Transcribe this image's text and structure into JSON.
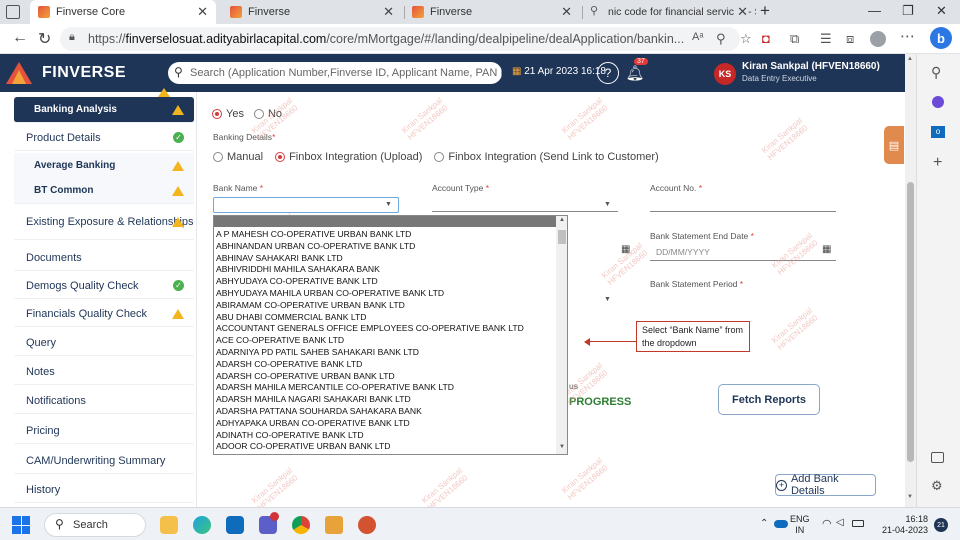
{
  "browser": {
    "tabs": [
      {
        "title": "Finverse Core",
        "active": true
      },
      {
        "title": "Finverse",
        "active": false
      },
      {
        "title": "Finverse",
        "active": false
      },
      {
        "title": "nic code for financial services - S",
        "active": false
      }
    ],
    "url_prefix": "https://",
    "url_host": "finverselosuat.adityabirlacapital.com",
    "url_path": "/core/mMortgage/#/landing/dealpipeline/dealApplication/bankin..."
  },
  "app": {
    "brand": "FINVERSE",
    "search_placeholder": "Search (Application Number,Finverse ID, Applicant Name, PAN Number)",
    "datetime": "21 Apr 2023 16:18",
    "notification_count": "37",
    "user_initials": "KS",
    "user_name": "Kiran Sankpal (HFVEN18660)",
    "user_role": "Data Entry Executive"
  },
  "sidebar": {
    "items": [
      {
        "label": "Banking Analysis",
        "status": "warn",
        "sub": true,
        "active": true
      },
      {
        "label": "Product Details",
        "status": "ok",
        "sub": false,
        "active": false
      },
      {
        "label": "Average Banking",
        "status": "warn",
        "sub": true,
        "active": false
      },
      {
        "label": "BT Common",
        "status": "warn",
        "sub": true,
        "active": false
      },
      {
        "label": "Existing Exposure & Relationships",
        "status": "warn",
        "sub": false,
        "active": false
      },
      {
        "label": "Documents",
        "status": "",
        "sub": false,
        "active": false
      },
      {
        "label": "Demogs Quality Check",
        "status": "ok",
        "sub": false,
        "active": false
      },
      {
        "label": "Financials Quality Check",
        "status": "warn",
        "sub": false,
        "active": false
      },
      {
        "label": "Query",
        "status": "",
        "sub": false,
        "active": false
      },
      {
        "label": "Notes",
        "status": "",
        "sub": false,
        "active": false
      },
      {
        "label": "Notifications",
        "status": "",
        "sub": false,
        "active": false
      },
      {
        "label": "Pricing",
        "status": "",
        "sub": false,
        "active": false
      },
      {
        "label": "CAM/Underwriting Summary",
        "status": "",
        "sub": false,
        "active": false
      },
      {
        "label": "History",
        "status": "",
        "sub": false,
        "active": false
      }
    ]
  },
  "form": {
    "yes_label": "Yes",
    "no_label": "No",
    "banking_details_label": "Banking Details",
    "mode_manual": "Manual",
    "mode_finbox_upload": "Finbox Integration (Upload)",
    "mode_finbox_link": "Finbox Integration (Send Link to Customer)",
    "bank_name_label": "Bank Name",
    "account_type_label": "Account Type",
    "account_no_label": "Account No.",
    "stmt_end_label": "Bank Statement End Date",
    "stmt_end_placeholder": "DD/MM/YYYY",
    "stmt_period_label": "Bank Statement Period",
    "status_label_partial": "us",
    "status_value_partial": "PROGRESS",
    "fetch_reports": "Fetch Reports",
    "add_bank_details": "Add Bank Details"
  },
  "bank_dropdown": {
    "options": [
      "A P MAHESH CO-OPERATIVE URBAN BANK LTD",
      "ABHINANDAN URBAN CO-OPERATIVE BANK LTD",
      "ABHINAV SAHAKARI BANK LTD",
      "ABHIVRIDDHI MAHILA SAHAKARA BANK",
      "ABHYUDAYA CO-OPERATIVE BANK LTD",
      "ABHYUDAYA MAHILA URBAN CO-OPERATIVE BANK LTD",
      "ABIRAMAM CO-OPERATIVE URBAN BANK LTD",
      "ABU DHABI COMMERCIAL BANK LTD",
      "ACCOUNTANT GENERALS OFFICE EMPLOYEES CO-OPERATIVE BANK LTD",
      "ACE CO-OPERATIVE BANK LTD",
      "ADARNIYA PD PATIL SAHEB SAHAKARI BANK LTD",
      "ADARSH CO-OPERATIVE BANK LTD",
      "ADARSH CO-OPERATIVE URBAN BANK LTD",
      "ADARSH MAHILA MERCANTILE CO-OPERATIVE BANK LTD",
      "ADARSH MAHILA NAGARI SAHAKARI BANK LTD",
      "ADARSHA PATTANA SOUHARDA SAHAKARA BANK",
      "ADHYAPAKA URBAN CO-OPERATIVE BANK LTD",
      "ADINATH CO-OPERATIVE BANK LTD",
      "ADOOR CO-OPERATIVE URBAN BANK LTD"
    ]
  },
  "callout": {
    "text": "Select “Bank Name” from the dropdown"
  },
  "watermark": {
    "line1": "Kiran Sankpal",
    "line2": "HFVEN18660"
  },
  "taskbar": {
    "search_label": "Search",
    "lang_top": "ENG",
    "lang_bottom": "IN",
    "time": "16:18",
    "date": "21-04-2023",
    "notif": "21"
  },
  "colors": {
    "header": "#1f3557",
    "accent": "#d23c3c",
    "ok": "#4caf50",
    "warn": "#f2b51d",
    "progress": "#2e7d32"
  }
}
